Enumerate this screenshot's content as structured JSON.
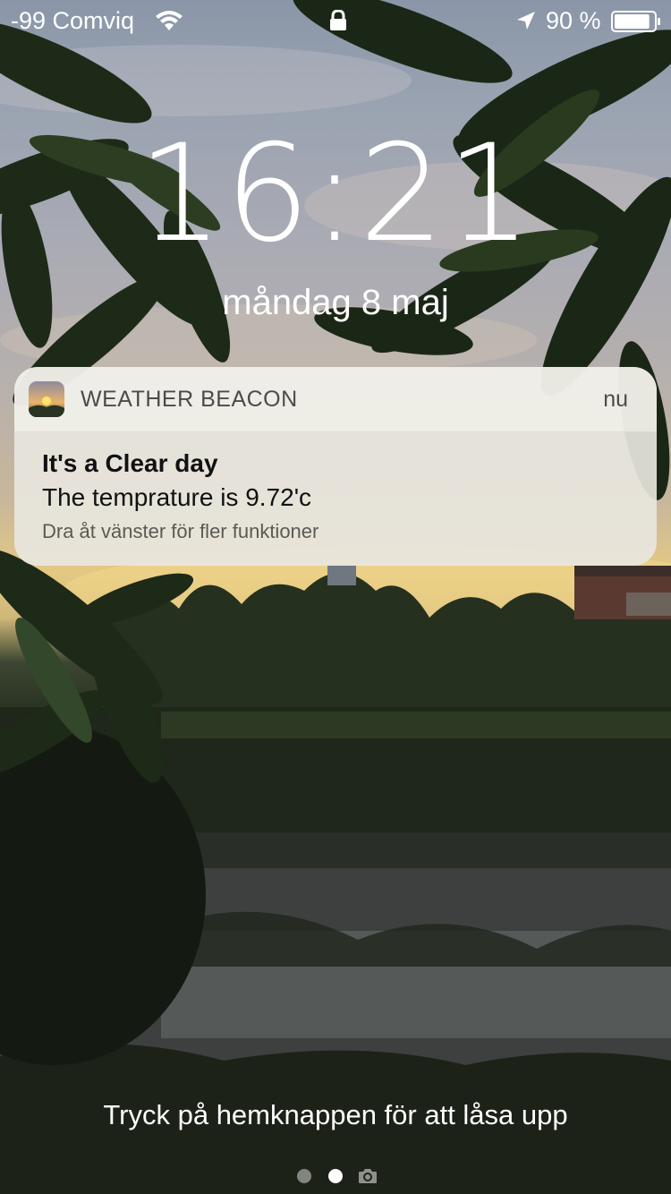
{
  "status_bar": {
    "carrier": "-99 Comviq",
    "battery_percent": "90 %",
    "battery_level": 0.9,
    "icons": [
      "wifi-icon",
      "lock-icon",
      "location-arrow-icon",
      "battery-icon"
    ]
  },
  "lock_screen": {
    "time": "16:21",
    "date": "måndag 8 maj"
  },
  "notification": {
    "app_name": "WEATHER BEACON",
    "time": "nu",
    "title": "It's a Clear day",
    "body": "The temprature is 9.72'c",
    "hint": "Dra åt vänster för fler funktioner",
    "app_icon": "sun-landscape-icon"
  },
  "footer": {
    "unlock_hint": "Tryck på hemknappen för att låsa upp",
    "page_count": 2,
    "current_page": 2,
    "camera_icon": "camera-icon"
  }
}
